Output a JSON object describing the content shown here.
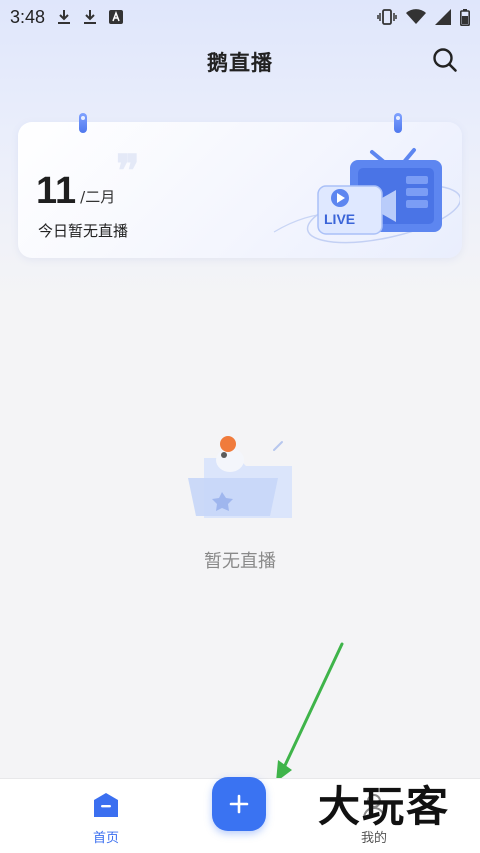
{
  "status_bar": {
    "time": "3:48",
    "icons_left": [
      "download-icon",
      "download-icon",
      "font-a-icon"
    ],
    "icons_right": [
      "vibrate-icon",
      "wifi-icon",
      "signal-icon",
      "battery-icon"
    ]
  },
  "header": {
    "title": "鹅直播",
    "search_icon": "search-icon"
  },
  "calendar_card": {
    "day": "11",
    "month": "/二月",
    "subtitle": "今日暂无直播",
    "illustration_badge": "LIVE"
  },
  "empty_state": {
    "text": "暂无直播"
  },
  "bottom_nav": {
    "home_label": "首页",
    "add_symbol": "+",
    "mine_label": "我的"
  },
  "watermark": {
    "text": "大玩客"
  },
  "colors": {
    "accent": "#3a73f2",
    "arrow": "#3fb44a",
    "muted_text": "#8a8a8a"
  }
}
